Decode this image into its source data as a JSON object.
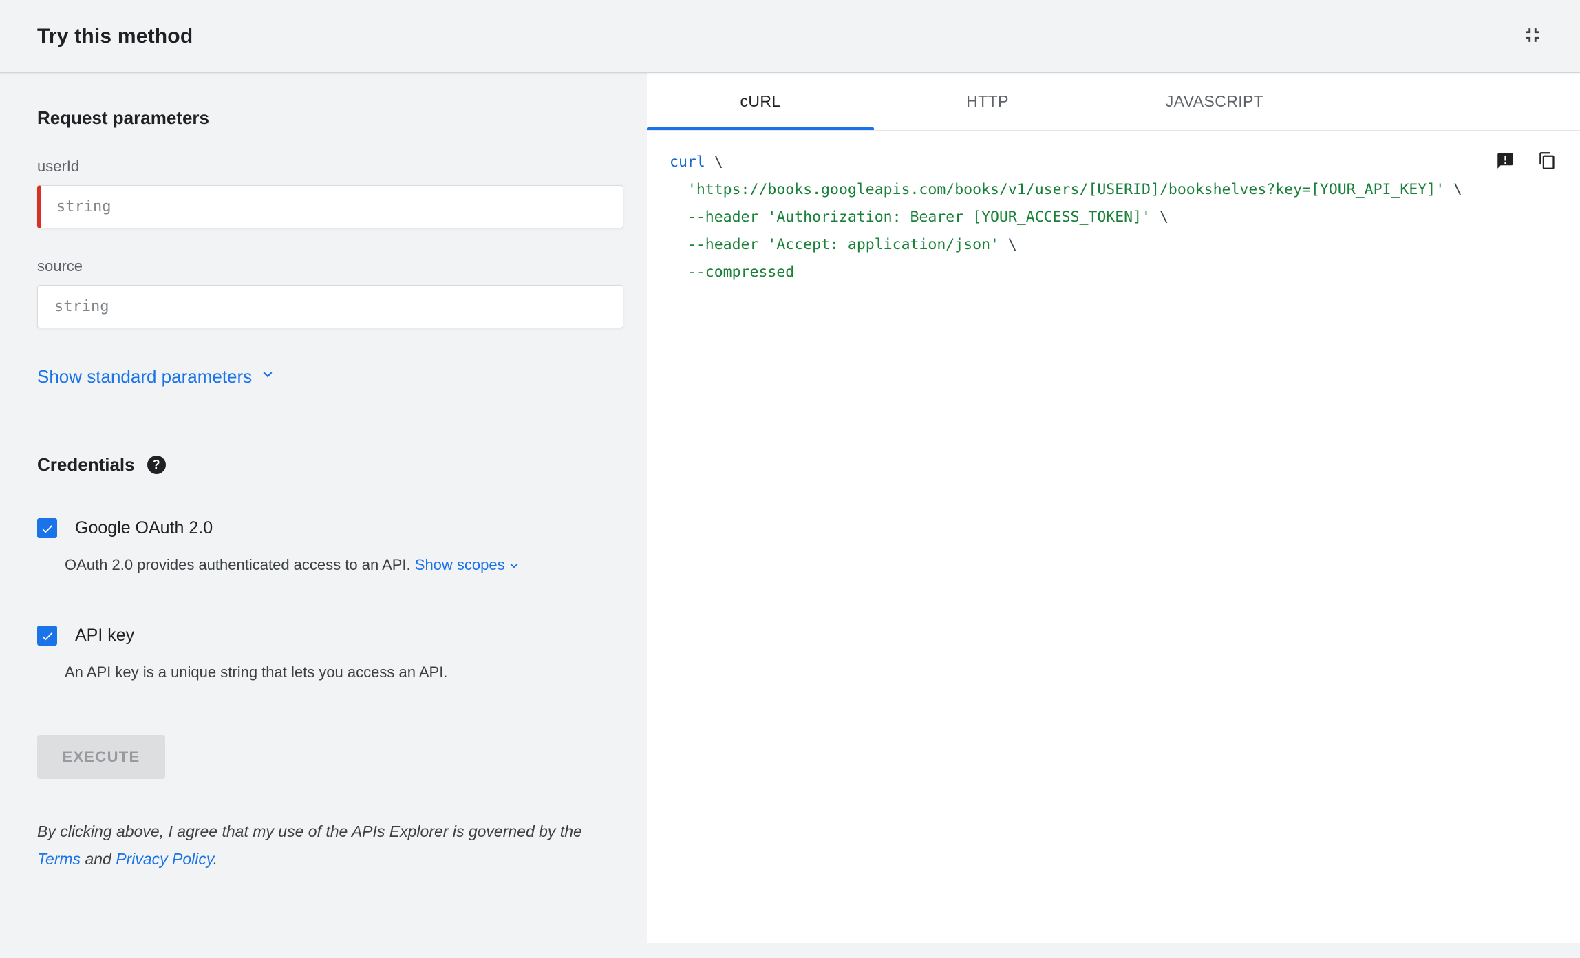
{
  "header": {
    "title": "Try this method"
  },
  "params": {
    "heading": "Request parameters",
    "fields": [
      {
        "label": "userId",
        "placeholder": "string",
        "required": true
      },
      {
        "label": "source",
        "placeholder": "string",
        "required": false
      }
    ],
    "show_standard_label": "Show standard parameters"
  },
  "credentials": {
    "heading": "Credentials",
    "oauth": {
      "label": "Google OAuth 2.0",
      "description": "OAuth 2.0 provides authenticated access to an API. ",
      "show_scopes_label": "Show scopes",
      "checked": true
    },
    "api_key": {
      "label": "API key",
      "description": "An API key is a unique string that lets you access an API.",
      "checked": true
    }
  },
  "execute": {
    "label": "EXECUTE"
  },
  "disclaimer": {
    "pre": "By clicking above, I agree that my use of the APIs Explorer is governed by the ",
    "terms_label": "Terms",
    "mid": " and ",
    "privacy_label": "Privacy Policy",
    "post": "."
  },
  "tabs": [
    {
      "label": "cURL",
      "active": true
    },
    {
      "label": "HTTP",
      "active": false
    },
    {
      "label": "JAVASCRIPT",
      "active": false
    }
  ],
  "code": {
    "lines": [
      [
        {
          "c": "kw",
          "t": "curl"
        },
        {
          "c": "pln",
          "t": " \\"
        }
      ],
      [
        {
          "c": "pln",
          "t": "  "
        },
        {
          "c": "str",
          "t": "'https://books.googleapis.com/books/v1/users/[USERID]/bookshelves?key=[YOUR_API_KEY]'"
        },
        {
          "c": "pln",
          "t": " \\"
        }
      ],
      [
        {
          "c": "pln",
          "t": "  "
        },
        {
          "c": "str",
          "t": "--header"
        },
        {
          "c": "pln",
          "t": " "
        },
        {
          "c": "str",
          "t": "'Authorization: Bearer [YOUR_ACCESS_TOKEN]'"
        },
        {
          "c": "pln",
          "t": " \\"
        }
      ],
      [
        {
          "c": "pln",
          "t": "  "
        },
        {
          "c": "str",
          "t": "--header"
        },
        {
          "c": "pln",
          "t": " "
        },
        {
          "c": "str",
          "t": "'Accept: application/json'"
        },
        {
          "c": "pln",
          "t": " \\"
        }
      ],
      [
        {
          "c": "pln",
          "t": "  "
        },
        {
          "c": "str",
          "t": "--compressed"
        }
      ]
    ]
  },
  "colors": {
    "accent_blue": "#1a73e8",
    "required_red": "#d93025",
    "code_keyword_blue": "#1967d2",
    "code_string_green": "#188038",
    "code_plain": "#37474f",
    "panel_gray": "#f1f3f4"
  }
}
